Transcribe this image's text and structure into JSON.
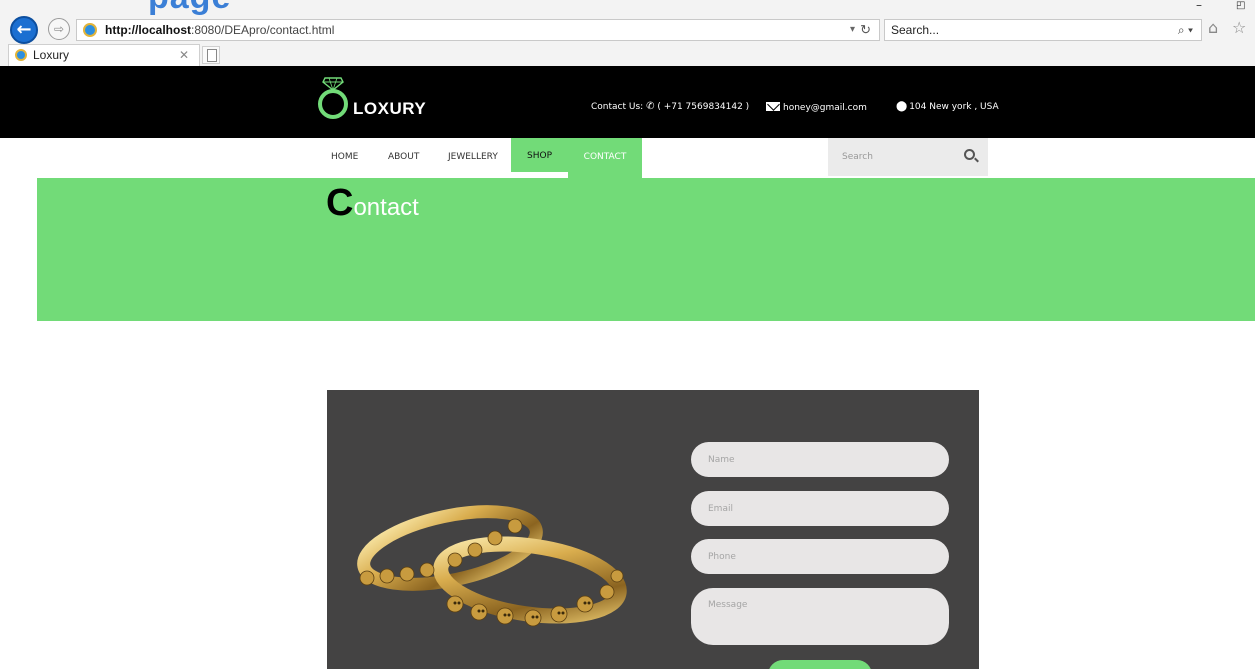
{
  "browser": {
    "url_host": "http://localhost",
    "url_rest": ":8080/DEApro/contact.html",
    "search_placeholder": "Search...",
    "tab_title": "Loxury",
    "decor_heading": "page"
  },
  "site": {
    "logo": "LOXURY",
    "contact_label": "Contact Us:",
    "phone": "( +71 7569834142 )",
    "email": "honey@gmail.com",
    "location": "104 New york , USA",
    "accent_color": "#72db78"
  },
  "nav": {
    "items": [
      "HOME",
      "ABOUT",
      "JEWELLERY",
      "SHOP",
      "CONTACT"
    ],
    "active": "CONTACT",
    "search_placeholder": "Search"
  },
  "banner": {
    "title_first": "C",
    "title_rest": "ontact"
  },
  "form": {
    "name_placeholder": "Name",
    "email_placeholder": "Email",
    "phone_placeholder": "Phone",
    "message_placeholder": "Message",
    "submit_label": ""
  }
}
